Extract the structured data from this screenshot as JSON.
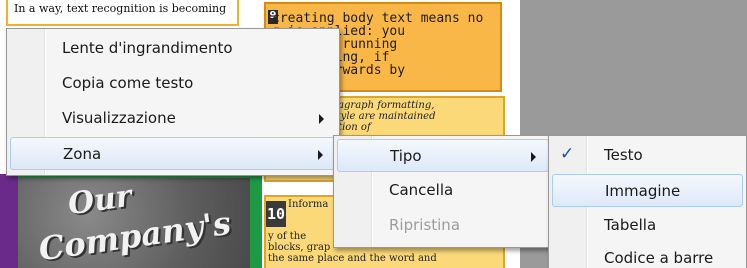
{
  "document": {
    "top_strip_text": "In a way, text recognition is becoming",
    "zone1_number": "9",
    "zone1_lines": "creating body text means no\ng is applied: you\ntinuous, running\n formatting, if\none afterwards by",
    "zone2_lines": "word and paragraph formatting,\nize and typestyle are maintained\nthe Classification of\nthe paragraph",
    "zone3_number": "10",
    "zone3_heading": "Informa",
    "zone3_lines": "y of the\nblocks, grap\nthe same place and the word and",
    "image_text_line1": "Our",
    "image_text_line2": "Company's"
  },
  "menus": {
    "main": {
      "items": [
        {
          "label": "Lente d'ingrandimento"
        },
        {
          "label": "Copia come testo"
        },
        {
          "label": "Visualizzazione"
        },
        {
          "label": "Zona"
        }
      ]
    },
    "zona": {
      "items": [
        {
          "label": "Tipo"
        },
        {
          "label": "Cancella"
        },
        {
          "label": "Ripristina"
        }
      ]
    },
    "tipo": {
      "items": [
        {
          "label": "Testo",
          "checked": true
        },
        {
          "label": "Immagine"
        },
        {
          "label": "Tabella"
        },
        {
          "label": "Codice a barre"
        }
      ]
    }
  },
  "colors": {
    "highlight_border": "#aecbf1",
    "check": "#1f4f9a",
    "zone_orange": "#f9b748",
    "zone_yellow": "#fbd878",
    "image_zone": "#1e9a44"
  }
}
